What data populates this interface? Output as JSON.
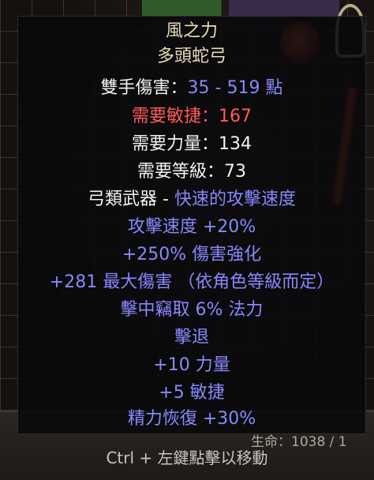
{
  "item": {
    "name": "風之力",
    "base_type": "多頭蛇弓",
    "damage": {
      "label": "雙手傷害：",
      "value": "35 - 519 點"
    },
    "requirements": [
      {
        "text": "需要敏捷：167",
        "color": "#ff5a5a"
      },
      {
        "text": "需要力量：134",
        "color": "#f2f2f2"
      },
      {
        "text": "需要等級：73",
        "color": "#f2f2f2"
      }
    ],
    "weapon_class": {
      "label": "弓類武器 - ",
      "speed": "快速的攻擊速度"
    },
    "mods": [
      "攻擊速度 +20%",
      "+250% 傷害強化",
      "+281 最大傷害 （依角色等級而定）",
      "擊中竊取 6% 法力",
      "擊退",
      "+10 力量",
      "+5 敏捷",
      "精力恢復 +30%"
    ]
  },
  "hud": {
    "life_text": "生命：1038 / 1",
    "hint": "Ctrl + 左鍵點擊以移動"
  },
  "colors": {
    "unique_name": "#e7dcb8",
    "magic_blue": "#8888ff",
    "unmet_red": "#ff5a5a",
    "white": "#f2f2f2"
  }
}
